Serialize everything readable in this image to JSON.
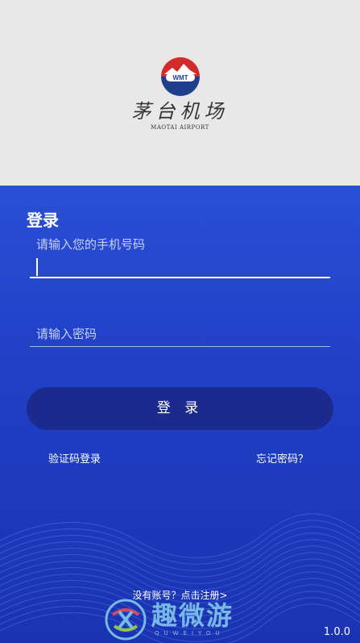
{
  "header": {
    "logo_badge_text": "WMT",
    "logo_name_cn": "茅台机场",
    "logo_name_en": "MAOTAI AIRPORT"
  },
  "login": {
    "title": "登录",
    "phone_placeholder": "请输入您的手机号码",
    "phone_value": "",
    "password_placeholder": "请输入密码",
    "password_value": "",
    "submit_label": "登 录",
    "sms_login_label": "验证码登录",
    "forgot_password_label": "忘记密码？",
    "register_label": "没有账号？点击注册>"
  },
  "watermark": {
    "text": "趣微游",
    "subtext": "QUWEIYOU"
  },
  "footer": {
    "version": "1.0.0"
  },
  "colors": {
    "primary_blue": "#2a4fd4",
    "button_navy": "#1b2a8c",
    "logo_red": "#d22b2b",
    "logo_blue": "#1f3e8c"
  }
}
